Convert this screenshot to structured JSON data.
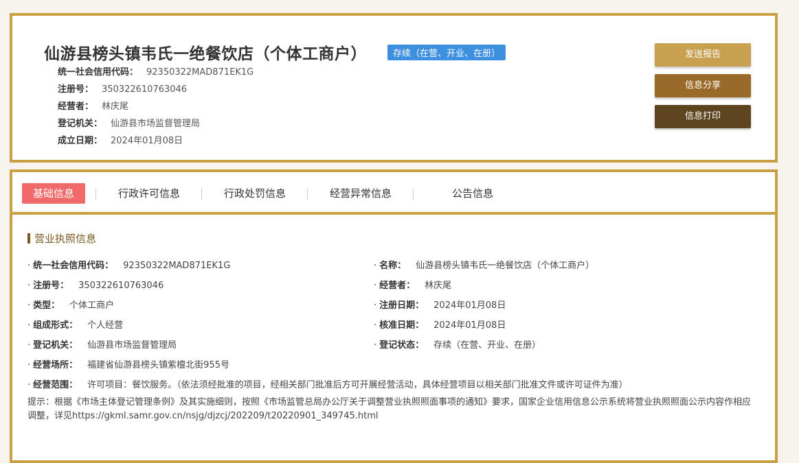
{
  "header": {
    "title": "仙游县榜头镇韦氏一绝餐饮店（个体工商户）",
    "status": "存续（在营、开业、在册）",
    "info": [
      {
        "label": "统一社会信用代码：",
        "value": "92350322MAD871EK1G"
      },
      {
        "label": "注册号：",
        "value": "350322610763046"
      },
      {
        "label": "经营者：",
        "value": "林庆尾"
      },
      {
        "label": "登记机关：",
        "value": "仙游县市场监督管理局"
      },
      {
        "label": "成立日期：",
        "value": "2024年01月08日"
      }
    ],
    "buttons": {
      "report": "发送报告",
      "share": "信息分享",
      "print": "信息打印"
    }
  },
  "tabs": [
    "基础信息",
    "行政许可信息",
    "行政处罚信息",
    "经营异常信息",
    "公告信息"
  ],
  "section": {
    "title": "营业执照信息"
  },
  "fields_left": [
    {
      "label": "统一社会信用代码：",
      "value": "92350322MAD871EK1G"
    },
    {
      "label": "注册号：",
      "value": "350322610763046"
    },
    {
      "label": "类型：",
      "value": "个体工商户"
    },
    {
      "label": "组成形式：",
      "value": "个人经营"
    },
    {
      "label": "登记机关：",
      "value": "仙游县市场监督管理局"
    },
    {
      "label": "经营场所：",
      "value": "福建省仙游县榜头镇紫檀北街955号"
    },
    {
      "label": "经营范围：",
      "value": "许可项目：餐饮服务。（依法须经批准的项目，经相关部门批准后方可开展经营活动，具体经营项目以相关部门批准文件或许可证件为准）"
    }
  ],
  "fields_right": [
    {
      "label": "名称：",
      "value": "仙游县榜头镇韦氏一绝餐饮店（个体工商户）"
    },
    {
      "label": "经营者：",
      "value": "林庆尾"
    },
    {
      "label": "注册日期：",
      "value": "2024年01月08日"
    },
    {
      "label": "核准日期：",
      "value": "2024年01月08日"
    },
    {
      "label": "登记状态：",
      "value": "存续（在营、开业、在册）"
    }
  ],
  "note": "提示：根据《市场主体登记管理条例》及其实施细则，按照《市场监管总局办公厅关于调整营业执照照面事项的通知》要求，国家企业信用信息公示系统将营业执照照面公示内容作相应调整，详见https://gkml.samr.gov.cn/nsjg/djzcj/202209/t20220901_349745.html",
  "colors": {
    "border": "#c9a043",
    "active_tab": "#f06a6a",
    "status": "#3d8fe0"
  }
}
